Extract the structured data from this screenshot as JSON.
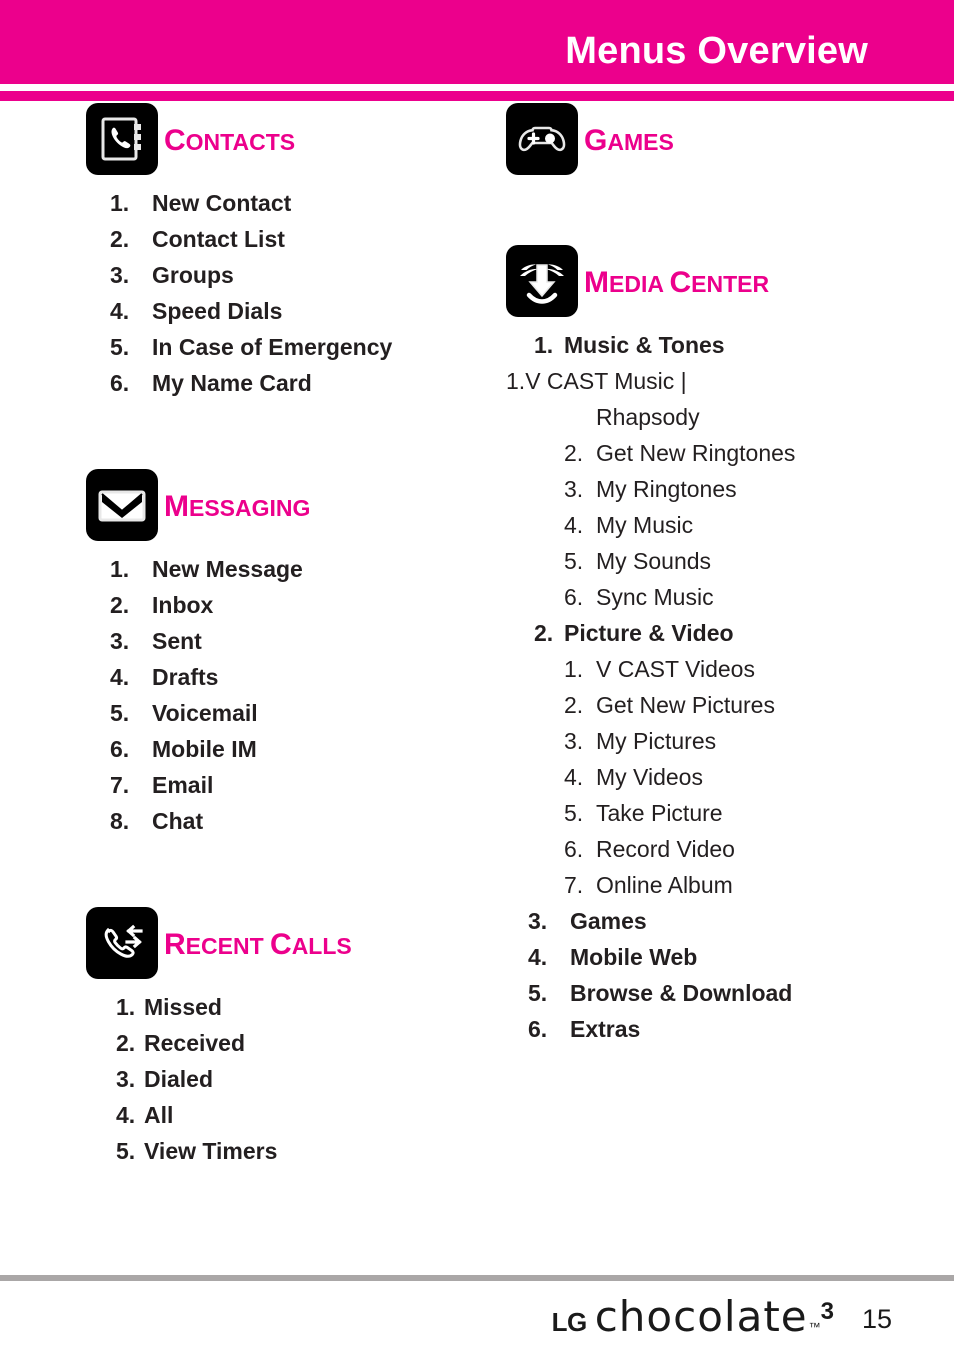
{
  "header": {
    "title": "Menus Overview",
    "bar_color": "#ec008c"
  },
  "theme": {
    "accent": "#ec008c",
    "text": "#231f20",
    "rule": "#aaa7a7",
    "icon_bg": "#000000"
  },
  "columns": {
    "left": [
      {
        "icon": "contacts-icon",
        "title_cap": "C",
        "title_rest": "ONTACTS",
        "items": [
          {
            "num": "1.",
            "label": "New Contact"
          },
          {
            "num": "2.",
            "label": "Contact List"
          },
          {
            "num": "3.",
            "label": "Groups"
          },
          {
            "num": "4.",
            "label": "Speed Dials"
          },
          {
            "num": "5.",
            "label": "In Case of Emergency"
          },
          {
            "num": "6.",
            "label": "My Name Card"
          }
        ]
      },
      {
        "icon": "messaging-icon",
        "title_cap": "M",
        "title_rest": "ESSAGING",
        "items": [
          {
            "num": "1.",
            "label": "New Message"
          },
          {
            "num": "2.",
            "label": "Inbox"
          },
          {
            "num": "3.",
            "label": "Sent"
          },
          {
            "num": "4.",
            "label": "Drafts"
          },
          {
            "num": "5.",
            "label": "Voicemail"
          },
          {
            "num": "6.",
            "label": "Mobile IM"
          },
          {
            "num": "7.",
            "label": "Email"
          },
          {
            "num": "8.",
            "label": "Chat"
          }
        ]
      },
      {
        "icon": "recent-calls-icon",
        "title_cap": "R",
        "title_rest": "ECENT ",
        "title_cap2": "C",
        "title_rest2": "ALLS",
        "items": [
          {
            "num": "1.",
            "label": "Missed"
          },
          {
            "num": "2.",
            "label": "Received"
          },
          {
            "num": "3.",
            "label": "Dialed"
          },
          {
            "num": "4.",
            "label": "All"
          },
          {
            "num": "5.",
            "label": "View Timers"
          }
        ]
      }
    ],
    "right": [
      {
        "icon": "games-icon",
        "title_cap": "G",
        "title_rest": "AMES",
        "items": []
      },
      {
        "icon": "media-center-icon",
        "title_cap": "M",
        "title_rest": "EDIA ",
        "title_cap2": "C",
        "title_rest2": "ENTER",
        "items": [
          {
            "num": "1.",
            "label": "Music & Tones",
            "sub": [
              {
                "num": "1.",
                "label": "V CAST Music |",
                "wrap": "Rhapsody"
              },
              {
                "num": "2.",
                "label": "Get New Ringtones"
              },
              {
                "num": "3.",
                "label": "My Ringtones"
              },
              {
                "num": "4.",
                "label": "My Music"
              },
              {
                "num": "5.",
                "label": "My Sounds"
              },
              {
                "num": "6.",
                "label": "Sync Music"
              }
            ]
          },
          {
            "num": "2.",
            "label": "Picture & Video",
            "sub": [
              {
                "num": "1.",
                "label": "V CAST Videos"
              },
              {
                "num": "2.",
                "label": "Get New Pictures"
              },
              {
                "num": "3.",
                "label": "My Pictures"
              },
              {
                "num": "4.",
                "label": "My Videos"
              },
              {
                "num": "5.",
                "label": "Take Picture"
              },
              {
                "num": "6.",
                "label": "Record Video"
              },
              {
                "num": "7.",
                "label": "Online Album"
              }
            ]
          },
          {
            "num": "3.",
            "label": "Games"
          },
          {
            "num": "4.",
            "label": "Mobile Web"
          },
          {
            "num": "5.",
            "label": "Browse & Download"
          },
          {
            "num": "6.",
            "label": "Extras"
          }
        ]
      }
    ]
  },
  "footer": {
    "brand_lg": "LG",
    "brand_product": "chocolate",
    "brand_tm": "™",
    "brand_version": "3",
    "page_number": "15"
  }
}
